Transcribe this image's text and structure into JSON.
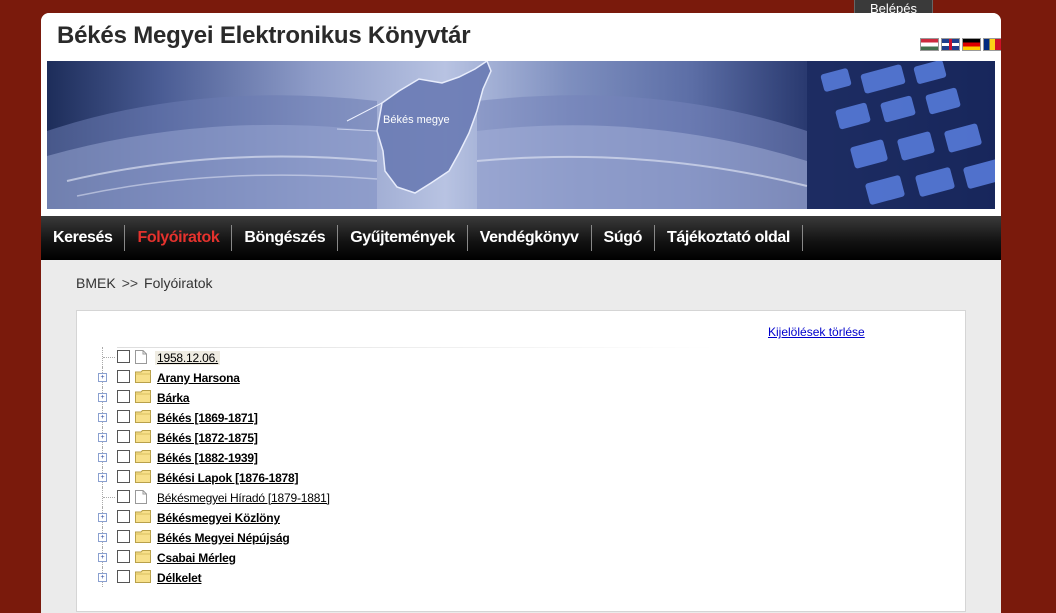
{
  "login": {
    "label": "Belépés"
  },
  "header": {
    "title": "Békés Megyei Elektronikus Könyvtár",
    "banner_label": "Békés megye",
    "flags": [
      {
        "name": "hu-flag-icon"
      },
      {
        "name": "en-flag-icon"
      },
      {
        "name": "de-flag-icon"
      },
      {
        "name": "ro-flag-icon"
      }
    ]
  },
  "nav": {
    "items": [
      {
        "label": "Keresés",
        "active": false
      },
      {
        "label": "Folyóiratok",
        "active": true
      },
      {
        "label": "Böngészés",
        "active": false
      },
      {
        "label": "Gyűjtemények",
        "active": false
      },
      {
        "label": "Vendégkönyv",
        "active": false
      },
      {
        "label": "Súgó",
        "active": false
      },
      {
        "label": "Tájékoztató oldal",
        "active": false
      }
    ]
  },
  "breadcrumb": {
    "root": "BMEK",
    "separator": ">>",
    "current": "Folyóiratok"
  },
  "content": {
    "clear_selection": "Kijelölések törlése",
    "tree": [
      {
        "label": "1958.12.06.",
        "type": "file",
        "expandable": false,
        "selected": true
      },
      {
        "label": "Arany Harsona",
        "type": "folder",
        "expandable": true
      },
      {
        "label": "Bárka",
        "type": "folder",
        "expandable": true
      },
      {
        "label": "Békés [1869-1871]",
        "type": "folder",
        "expandable": true
      },
      {
        "label": "Békés [1872-1875]",
        "type": "folder",
        "expandable": true
      },
      {
        "label": "Békés [1882-1939]",
        "type": "folder",
        "expandable": true
      },
      {
        "label": "Békési Lapok [1876-1878]",
        "type": "folder",
        "expandable": true
      },
      {
        "label": "Békésmegyei Híradó [1879-1881]",
        "type": "file",
        "expandable": false
      },
      {
        "label": "Békésmegyei Közlöny",
        "type": "folder",
        "expandable": true
      },
      {
        "label": "Békés Megyei Népújság",
        "type": "folder",
        "expandable": true
      },
      {
        "label": "Csabai Mérleg",
        "type": "folder",
        "expandable": true
      },
      {
        "label": "Délkelet",
        "type": "folder",
        "expandable": true
      }
    ]
  }
}
